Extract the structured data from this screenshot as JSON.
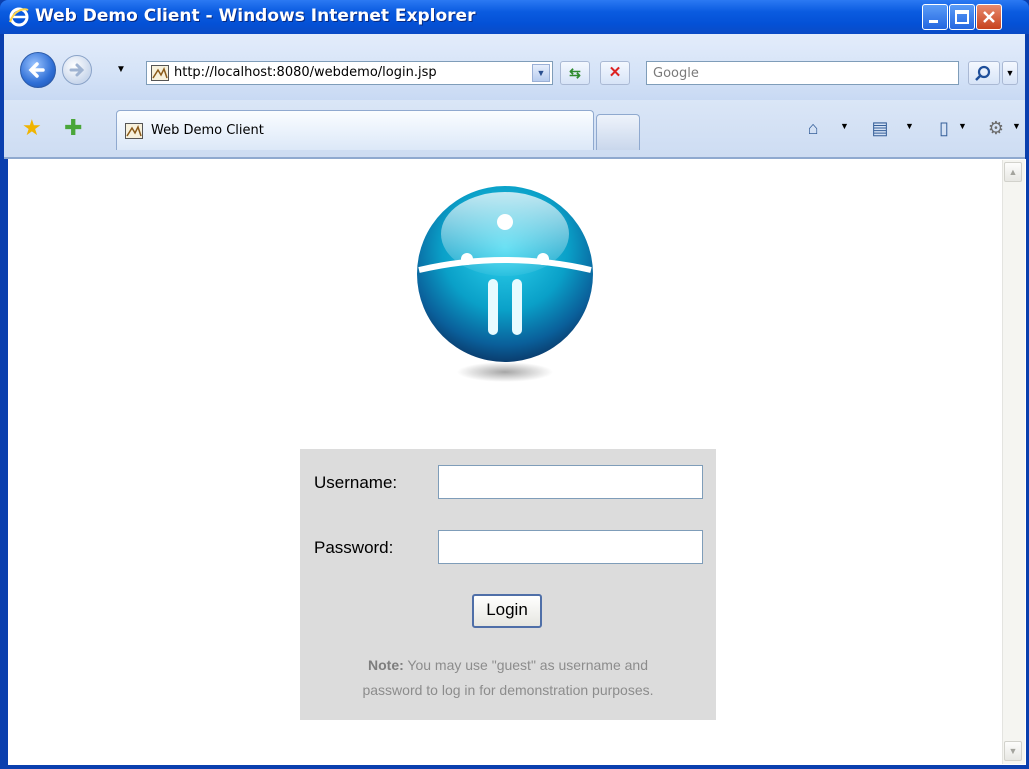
{
  "window": {
    "title": "Web Demo Client - Windows Internet Explorer"
  },
  "navigation": {
    "address": "http://localhost:8080/webdemo/login.jsp",
    "search_placeholder": "Google"
  },
  "tabs": [
    {
      "label": "Web Demo Client"
    }
  ],
  "login_form": {
    "username_label": "Username:",
    "username_value": "",
    "password_label": "Password:",
    "password_value": "",
    "login_button": "Login",
    "note_bold": "Note:",
    "note_line1": " You may use \"guest\" as username and",
    "note_line2": "password to log in for demonstration purposes."
  },
  "colors": {
    "titlebar": "#0a5be0",
    "login_box_bg": "#dcdcdc",
    "logo_primary": "#1aa6c9"
  },
  "icons": [
    "ie-logo-icon",
    "back-icon",
    "forward-icon",
    "refresh-icon",
    "stop-icon",
    "search-icon",
    "favorites-star-icon",
    "add-favorites-icon",
    "home-icon",
    "print-icon",
    "page-icon",
    "tools-gear-icon",
    "site-logo-icon"
  ]
}
